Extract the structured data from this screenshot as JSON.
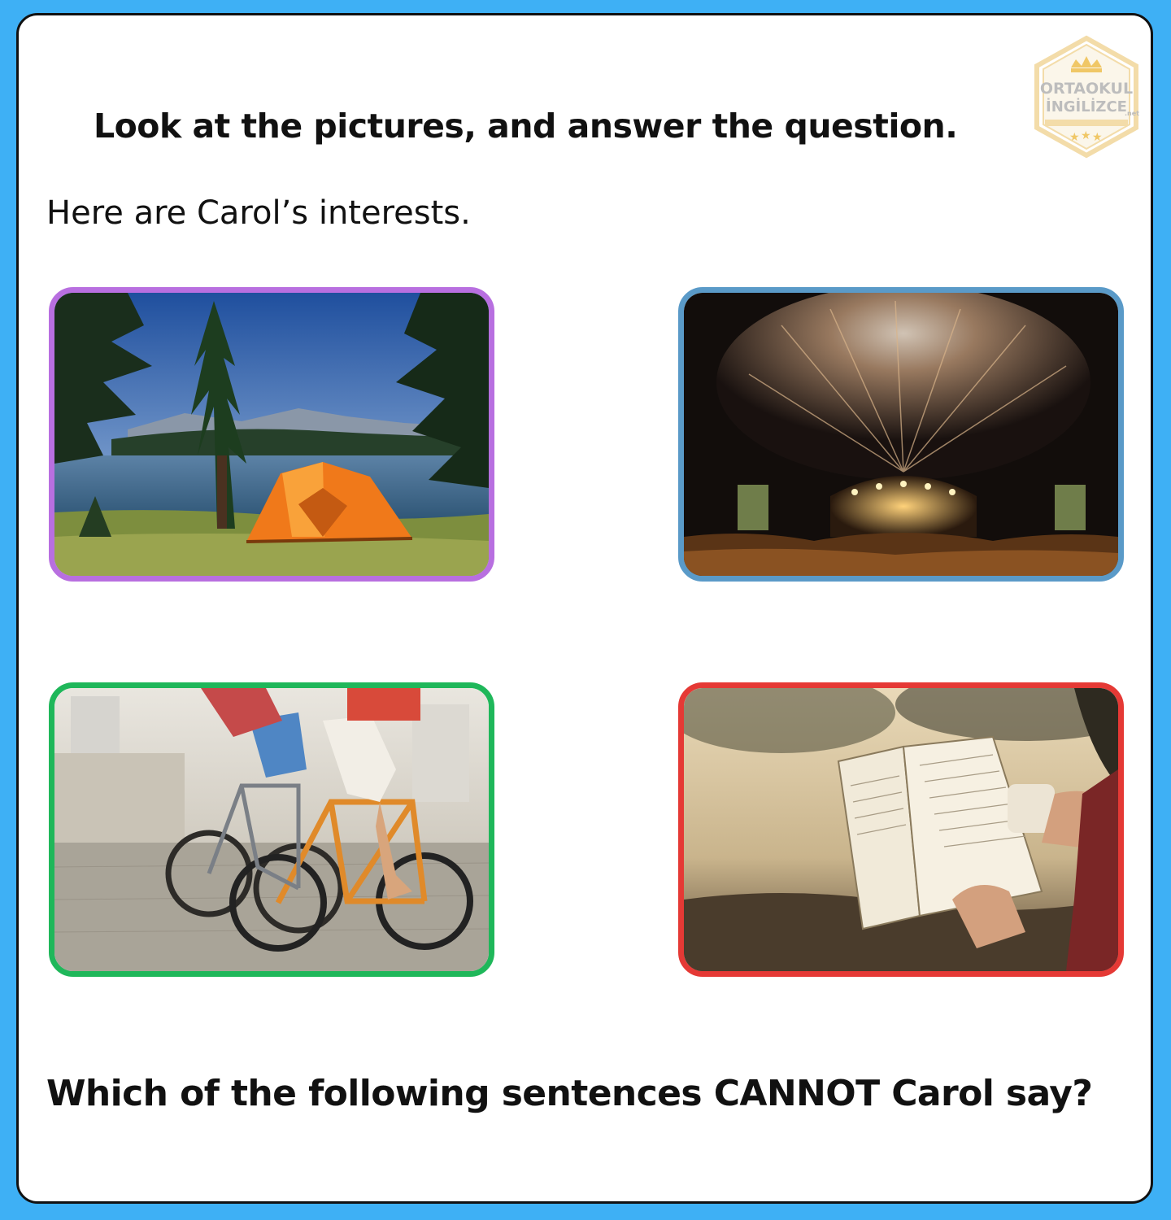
{
  "logo": {
    "line1": "ORTAOKUL",
    "line2": "İNGİLİZCE",
    "suffix": ".net",
    "accent_color": "#f4d9a6"
  },
  "instruction": "Look at the pictures, and answer the question.",
  "intro": "Here are Carol’s interests.",
  "pictures": [
    {
      "subject": "camping-tent-by-lake",
      "border_color": "#b86fe0"
    },
    {
      "subject": "concert-with-fireworks",
      "border_color": "#5a9ac8"
    },
    {
      "subject": "cycling-bicycles",
      "border_color": "#1fb75a"
    },
    {
      "subject": "reading-book-with-tea",
      "border_color": "#e53935"
    }
  ],
  "question": "Which of the following sentences CANNOT Carol say?",
  "colors": {
    "page_background": "#3eb0f5",
    "card_background": "#ffffff",
    "text": "#111111"
  }
}
